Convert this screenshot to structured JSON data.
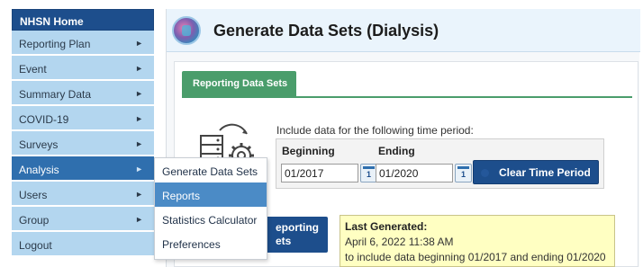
{
  "nav": {
    "home": "NHSN Home",
    "items": [
      {
        "label": "Reporting Plan",
        "arrow": "►"
      },
      {
        "label": "Event",
        "arrow": "►"
      },
      {
        "label": "Summary Data",
        "arrow": "►"
      },
      {
        "label": "COVID-19",
        "arrow": "►"
      },
      {
        "label": "Surveys",
        "arrow": "►"
      },
      {
        "label": "Analysis",
        "arrow": "►"
      },
      {
        "label": "Users",
        "arrow": "►"
      },
      {
        "label": "Group",
        "arrow": "►"
      },
      {
        "label": "Logout",
        "arrow": ""
      }
    ]
  },
  "header": {
    "title": "Generate Data Sets (Dialysis)",
    "icon": "dialysis-globe-icon"
  },
  "tab": {
    "label": "Reporting Data Sets"
  },
  "period": {
    "instruction": "Include data for the following time period:",
    "beginning_label": "Beginning",
    "ending_label": "Ending",
    "beginning_value": "01/2017",
    "ending_value": "01/2020",
    "calendar_glyph": "1",
    "clear_label": "Clear Time Period"
  },
  "generate_button": {
    "line1": "eporting",
    "line2": "ets"
  },
  "last_generated": {
    "heading": "Last Generated:",
    "timestamp": "April 6, 2022 11:38 AM",
    "note": "to include data beginning 01/2017 and ending 01/2020"
  },
  "flyout": {
    "items": [
      "Generate Data Sets",
      "Reports",
      "Statistics Calculator",
      "Preferences"
    ]
  },
  "colors": {
    "nav_home": "#1d4e8c",
    "nav_item": "#b3d6ef",
    "nav_active": "#2f6fae",
    "tab": "#4a9d6b",
    "button": "#1d4e8c",
    "note_bg": "#ffffc2",
    "flyout_hover": "#4b8bc6"
  }
}
